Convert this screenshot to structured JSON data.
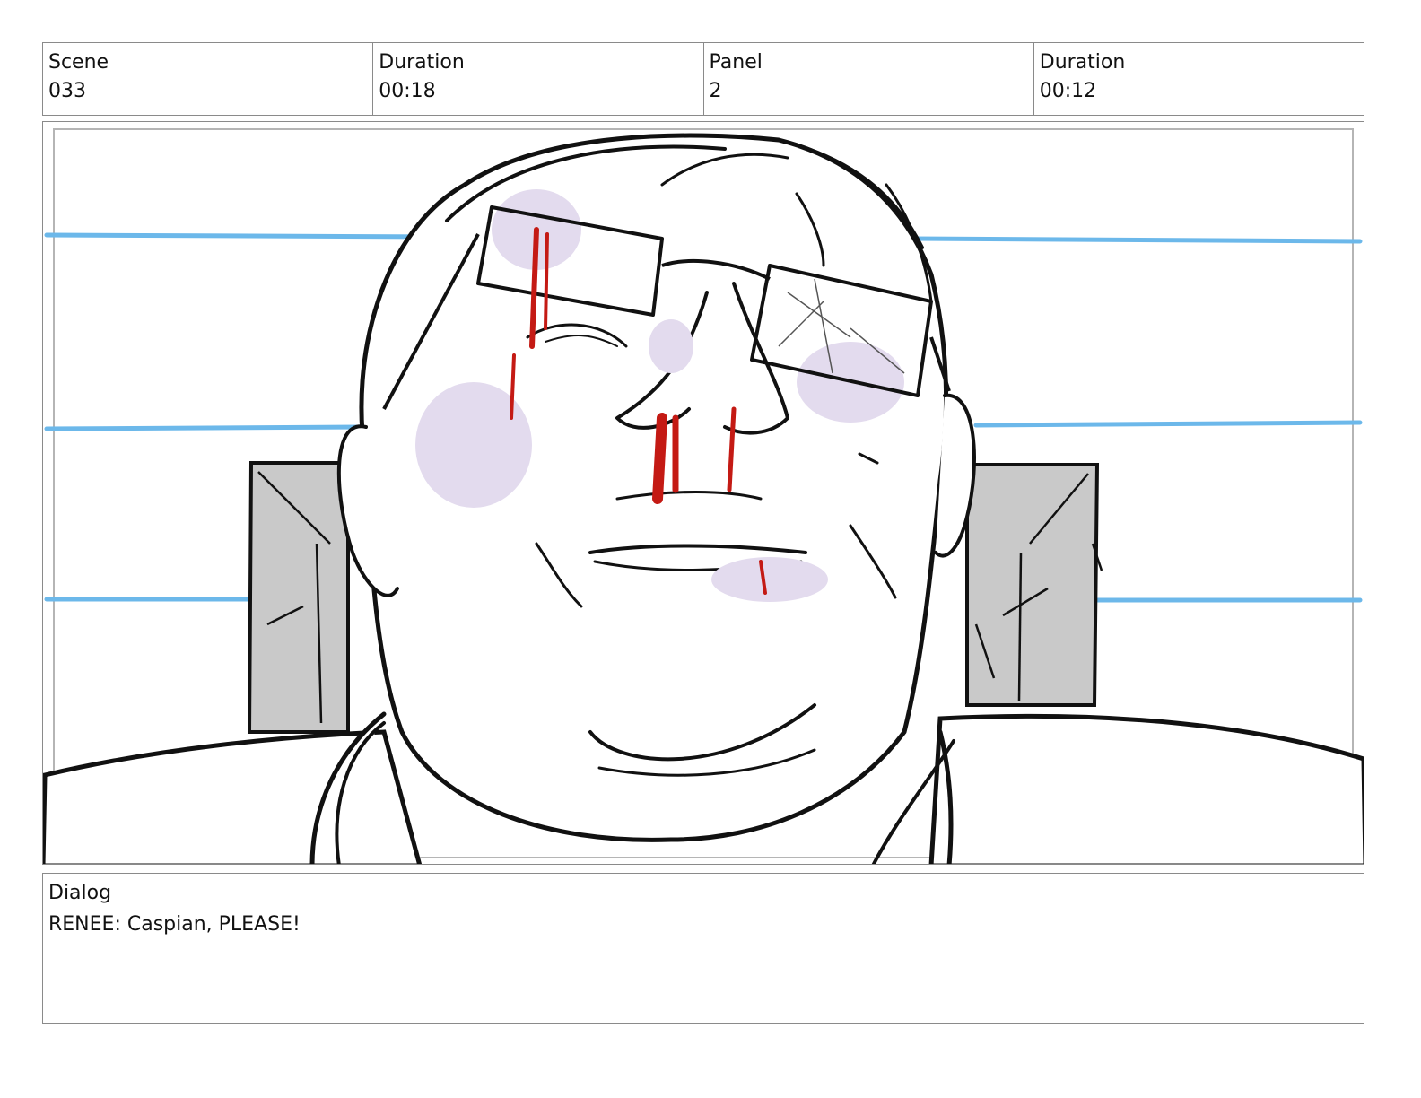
{
  "header": {
    "scene_label": "Scene",
    "scene_value": "033",
    "scene_duration_label": "Duration",
    "scene_duration_value": "00:18",
    "panel_label": "Panel",
    "panel_value": "2",
    "panel_duration_label": "Duration",
    "panel_duration_value": "00:12"
  },
  "dialog": {
    "label": "Dialog",
    "text": "RENEE: Caspian, PLEASE!"
  },
  "colors": {
    "guide_line": "#6cb8ea",
    "bruise": "#e3dbee",
    "blood": "#c41a14",
    "background_block": "#c9c9c9"
  }
}
